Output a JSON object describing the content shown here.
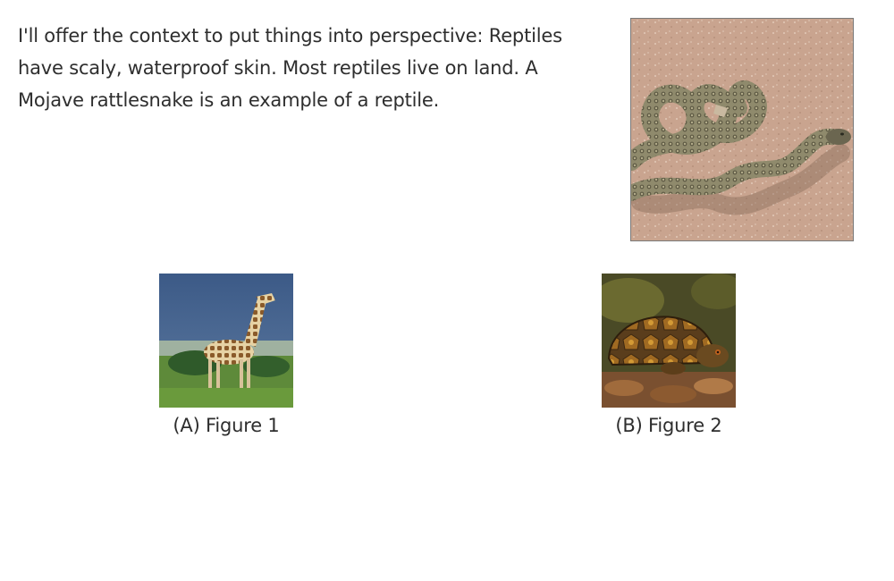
{
  "context": {
    "text": "I'll offer the context to put things into perspective: Reptiles have scaly, waterproof skin. Most reptiles live on land. A Mojave rattlesnake is an example of a reptile."
  },
  "options": [
    {
      "label": "(A) Figure 1"
    },
    {
      "label": "(B) Figure 2"
    }
  ]
}
